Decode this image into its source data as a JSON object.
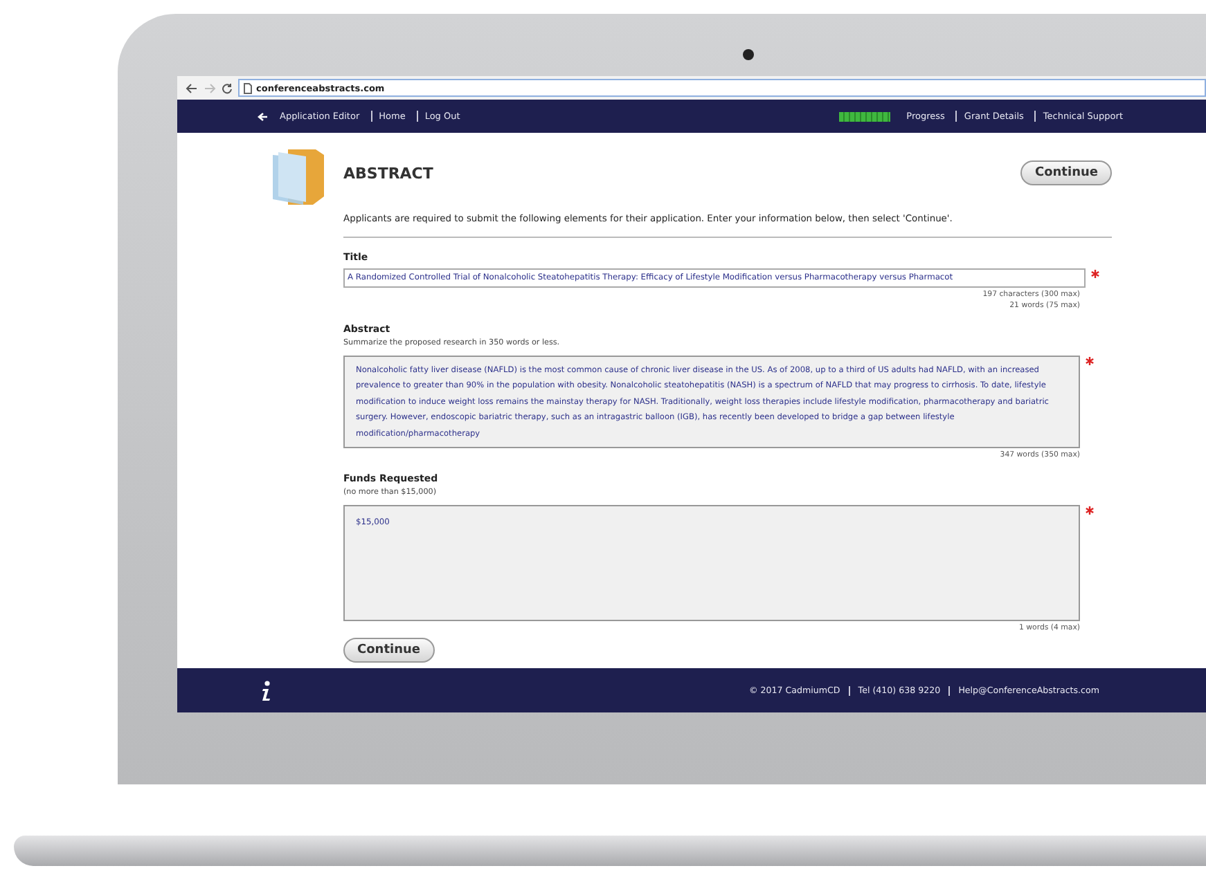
{
  "browser": {
    "url": "conferenceabstracts.com"
  },
  "nav": {
    "left": [
      {
        "label": "Application Editor",
        "kind": "back"
      },
      {
        "label": "Home",
        "kind": "link"
      },
      {
        "label": "Log Out",
        "kind": "link"
      }
    ],
    "right": [
      {
        "label": "Progress",
        "kind": "progress",
        "level": 1
      },
      {
        "label": "Grant Details",
        "kind": "link"
      },
      {
        "label": "Technical Support",
        "kind": "link"
      }
    ]
  },
  "header": {
    "title": "ABSTRACT",
    "button": "Continue"
  },
  "intro": "Applicants are required to submit the following elements for their application. Enter your information below, then select 'Continue'.",
  "fields": [
    {
      "kind": "input",
      "label": "Title",
      "value": "A Randomized Controlled Trial of Nonalcoholic Steatohepatitis Therapy: Efficacy of Lifestyle Modification versus Pharmacotherapy versus Pharmacot",
      "required": true,
      "counters": [
        "197 characters (300 max)",
        "21 words (75 max)"
      ]
    },
    {
      "kind": "textarea",
      "label": "Abstract",
      "hint": "Summarize the proposed research in 350 words or less.",
      "value": "Nonalcoholic fatty liver disease (NAFLD) is the most common cause of chronic liver disease in the US. As of 2008, up to a third of US adults had NAFLD, with an increased prevalence to greater than 90% in the population with obesity. Nonalcoholic steatohepatitis (NASH) is a spectrum of NAFLD that may progress to cirrhosis. To date, lifestyle modification to induce weight loss remains the mainstay therapy for NASH. Traditionally, weight loss therapies include lifestyle modification, pharmacotherapy and bariatric surgery. However, endoscopic bariatric therapy, such as an intragastric balloon (IGB), has recently been developed to bridge a gap between lifestyle modification/pharmacotherapy",
      "required": true,
      "counters": [
        "347 words (350 max)"
      ]
    },
    {
      "kind": "tall",
      "label": "Funds Requested",
      "hint": "(no more than $15,000)",
      "value": "$15,000",
      "required": true,
      "counters": [
        "1 words (4 max)"
      ]
    }
  ],
  "bottom_button": "Continue",
  "footer": [
    "© 2017 CadmiumCD",
    "Tel (410) 638 9220",
    "Help@ConferenceAbstracts.com"
  ]
}
